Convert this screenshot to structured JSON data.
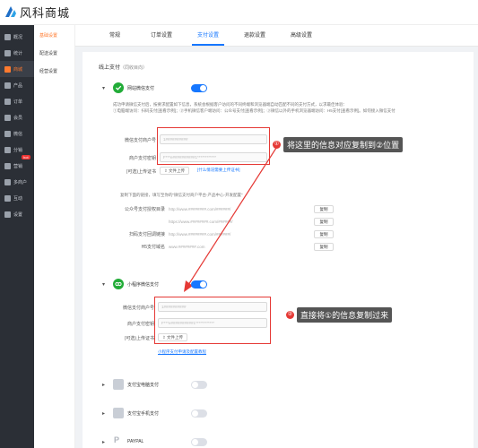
{
  "app": {
    "title": "风科商城"
  },
  "sidebar": {
    "items": [
      {
        "label": "概况"
      },
      {
        "label": "统计"
      },
      {
        "label": "商城"
      },
      {
        "label": "产品"
      },
      {
        "label": "订单"
      },
      {
        "label": "会员"
      },
      {
        "label": "微信"
      },
      {
        "label": "分销"
      },
      {
        "label": "营销"
      },
      {
        "label": "多商户"
      },
      {
        "label": "互动"
      },
      {
        "label": "设置"
      }
    ],
    "hot_badge": "hot"
  },
  "subnav": {
    "items": [
      {
        "label": "基础设置"
      },
      {
        "label": "配送设置"
      },
      {
        "label": "经营设置"
      }
    ]
  },
  "tabs": [
    {
      "label": "常规"
    },
    {
      "label": "订单设置"
    },
    {
      "label": "支付设置"
    },
    {
      "label": "退款设置"
    },
    {
      "label": "高级设置"
    }
  ],
  "section": {
    "title": "线上支付",
    "hint": "（同收目向）"
  },
  "wechat": {
    "name": "网站微信支付",
    "notes": [
      "成功申请微信支付后，按要求配置如下信息，系统会根据客户访问的不同终端和浏览器端自动匹配不同的支付方式，以求最佳体验：",
      "①电脑端访问：扫码支付[查看示例]；②手机微信客户端访问：公众号支付[查看示例]；③微信以外的手机浏览器端访问：H5支付[查看示例]。如何接入微信支付"
    ],
    "fields": [
      {
        "label": "微信支付商户号",
        "value": "1##########"
      },
      {
        "label": "商户支付密钥",
        "value": "F***e##########1************"
      },
      {
        "label": "(可选)上传证书"
      }
    ],
    "upload_label": "文件上传",
    "cert_link": "[什么情况需要上传证书]",
    "copy_hint": "复制下面的链接，填写至你的“微信支付商户平台-产品中心-开发配置”",
    "links": [
      {
        "label": "公众号支付授权目录",
        "value": "http://www.########.com/######/"
      },
      {
        "label": "",
        "value": "https://www.########.com/######/"
      },
      {
        "label": "扫码支付回调链接",
        "value": "http://www.########.com/######/"
      },
      {
        "label": "H5支付域名",
        "value": "www.########.com"
      }
    ],
    "copy_label": "复制"
  },
  "miniprogram": {
    "name": "小程序微信支付",
    "fields": [
      {
        "label": "微信支付商户号",
        "value": "1##########"
      },
      {
        "label": "商户支付密钥",
        "value": "F***e##########1************"
      },
      {
        "label": "(可选)上传证书"
      }
    ],
    "upload_label": "文件上传",
    "help_link": "小程序支付申请及配置教程"
  },
  "others": [
    {
      "name": "支付宝电脑支付"
    },
    {
      "name": "支付宝手机支付"
    },
    {
      "name": "PAYPAL"
    }
  ],
  "annotations": {
    "callout1": {
      "num": "①",
      "text": "将这里的信息对应复制到②位置"
    },
    "callout2": {
      "num": "②",
      "text": "直接将①的信息复制过来"
    }
  },
  "colors": {
    "accent": "#ff7a2f",
    "primary": "#1677ff",
    "annotation_red": "#e53935"
  }
}
